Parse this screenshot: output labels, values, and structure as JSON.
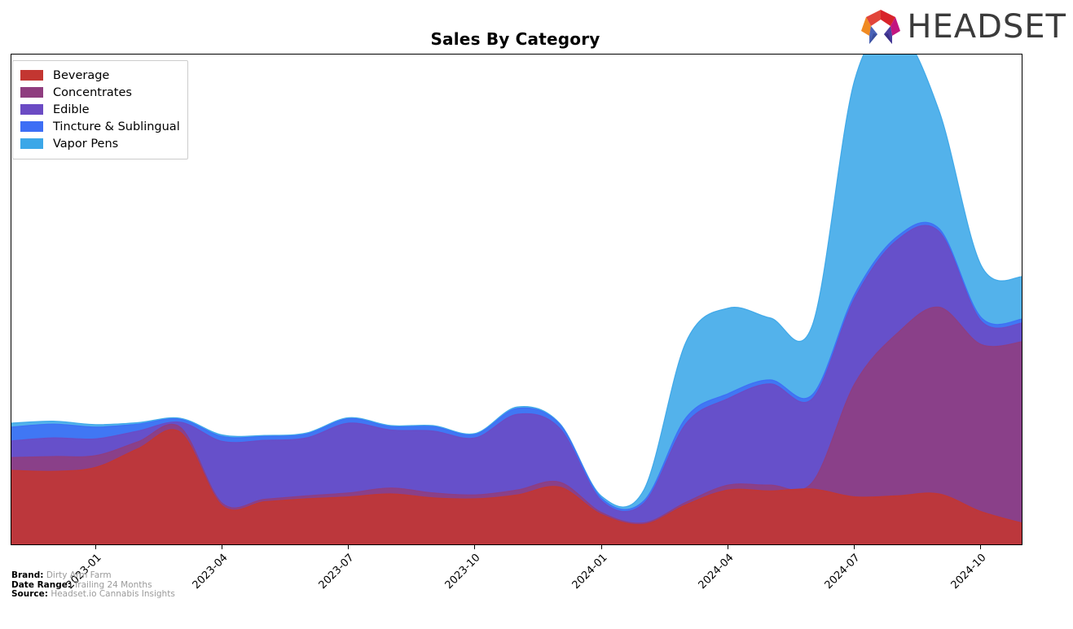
{
  "header": {
    "title": "Sales By Category",
    "logo_text": "HEADSET",
    "logo_icon": "headset-hexagon-logo"
  },
  "footer": {
    "brand_key": "Brand:",
    "brand_value": "Dirty Arm Farm",
    "date_range_key": "Date Range:",
    "date_range_value": "Trailing 24 Months",
    "source_key": "Source:",
    "source_value": "Headset.io Cannabis Insights"
  },
  "legend": {
    "position": "upper-left",
    "items": [
      {
        "label": "Beverage",
        "color": "#c33631"
      },
      {
        "label": "Concentrates",
        "color": "#8f3d7f"
      },
      {
        "label": "Edible",
        "color": "#6b4bc4"
      },
      {
        "label": "Tincture & Sublingual",
        "color": "#3d6ef5"
      },
      {
        "label": "Vapor Pens",
        "color": "#3ba7e8"
      }
    ]
  },
  "chart_data": {
    "type": "area",
    "stacked": true,
    "smoothing": "spline",
    "title": "Sales By Category",
    "xlabel": "",
    "ylabel": "",
    "grid": false,
    "legend_position": "upper left",
    "x": [
      "2022-11",
      "2022-12",
      "2023-01",
      "2023-02",
      "2023-03",
      "2023-04",
      "2023-05",
      "2023-06",
      "2023-07",
      "2023-08",
      "2023-09",
      "2023-10",
      "2023-11",
      "2023-12",
      "2024-01",
      "2024-02",
      "2024-03",
      "2024-04",
      "2024-05",
      "2024-06",
      "2024-07",
      "2024-08",
      "2024-09",
      "2024-10",
      "2024-11"
    ],
    "xtick_labels": [
      "2023-01",
      "2023-04",
      "2023-07",
      "2023-10",
      "2024-01",
      "2024-04",
      "2024-07",
      "2024-10"
    ],
    "xtick_positions": [
      2,
      5,
      8,
      11,
      14,
      17,
      20,
      23
    ],
    "yaxis_visible": false,
    "ylim": [
      0,
      100
    ],
    "series": [
      {
        "name": "Beverage",
        "color": "#c33631",
        "values": [
          15.4,
          15.2,
          16.0,
          19.8,
          23.2,
          8.2,
          9.0,
          9.6,
          10.0,
          10.6,
          9.8,
          9.6,
          10.4,
          12.0,
          6.4,
          4.4,
          8.4,
          11.4,
          11.2,
          11.6,
          10.0,
          10.2,
          10.6,
          7.0,
          4.6
        ]
      },
      {
        "name": "Concentrates",
        "color": "#8f3d7f",
        "values": [
          2.6,
          3.0,
          2.4,
          1.4,
          1.0,
          0.5,
          0.5,
          0.6,
          0.8,
          1.2,
          1.0,
          0.8,
          1.0,
          1.0,
          0.4,
          0.3,
          0.5,
          1.0,
          1.2,
          1.4,
          23.0,
          33.0,
          38.0,
          34.0,
          37.0
        ]
      },
      {
        "name": "Edible",
        "color": "#6b4bc4",
        "values": [
          3.4,
          3.8,
          3.4,
          2.2,
          1.0,
          12.6,
          12.0,
          11.8,
          14.2,
          11.8,
          12.6,
          11.6,
          15.4,
          11.0,
          2.4,
          4.0,
          16.0,
          17.6,
          20.6,
          17.0,
          17.4,
          19.0,
          15.4,
          4.8,
          3.8
        ]
      },
      {
        "name": "Tincture & Sublingual",
        "color": "#3d6ef5",
        "values": [
          2.8,
          2.8,
          2.4,
          1.4,
          0.6,
          1.0,
          0.8,
          0.8,
          0.9,
          0.7,
          0.9,
          0.7,
          1.2,
          0.8,
          0.5,
          0.5,
          1.2,
          1.0,
          0.8,
          0.8,
          0.8,
          0.7,
          0.6,
          0.7,
          0.8
        ]
      },
      {
        "name": "Vapor Pens",
        "color": "#3ba7e8",
        "values": [
          0.8,
          0.6,
          0.5,
          0.3,
          0.2,
          0.3,
          0.2,
          0.2,
          0.2,
          0.2,
          0.2,
          0.2,
          0.3,
          0.2,
          0.4,
          2.2,
          15.4,
          17.4,
          12.6,
          14.2,
          43.6,
          42.0,
          24.0,
          10.6,
          8.6
        ]
      }
    ]
  }
}
